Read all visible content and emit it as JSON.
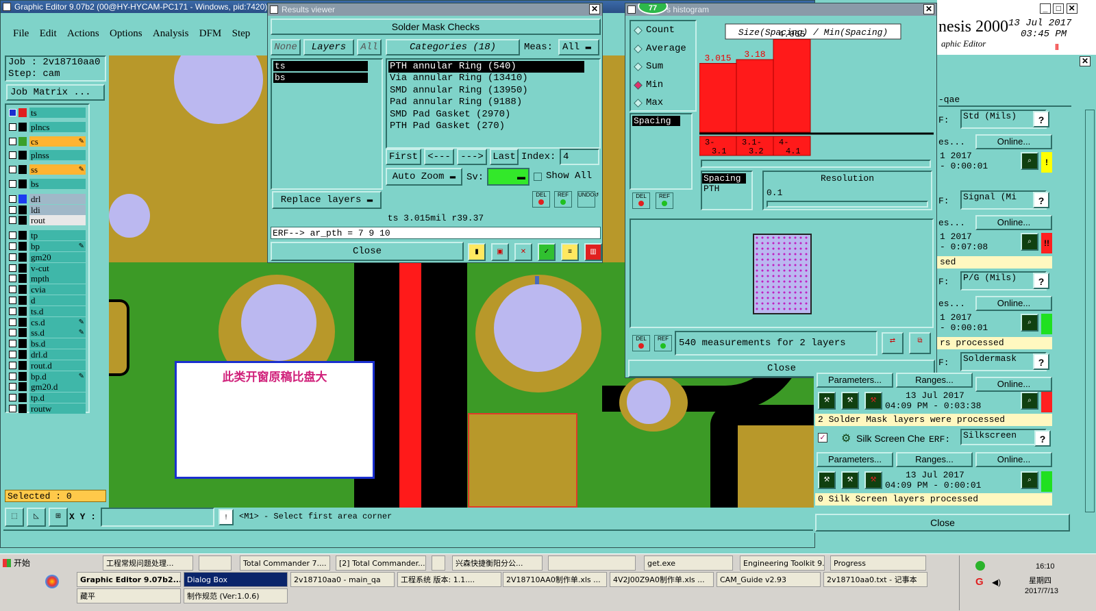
{
  "main": {
    "title": "Graphic Editor 9.07b2 (00@HY-HYCAM-PC171 - Windows, pid:7420)",
    "menu": [
      "File",
      "Edit",
      "Actions",
      "Options",
      "Analysis",
      "DFM",
      "Step"
    ],
    "job_label": "Job : 2v18710aa0",
    "step_label": "Step: cam",
    "job_matrix_button": "Job Matrix ...",
    "layers": [
      {
        "name": "ts",
        "color": "#e02020",
        "active": true
      },
      {
        "name": "plncs",
        "color": "#000000"
      },
      {
        "name": "cs",
        "color": "#3aa02a",
        "highlight": true,
        "mark": true
      },
      {
        "name": "plnss",
        "color": "#000000"
      },
      {
        "name": "ss",
        "color": "#000000",
        "highlight": true,
        "mark": true
      },
      {
        "name": "bs",
        "color": "#000000"
      },
      {
        "name": "drl",
        "color": "#1b3df0",
        "grey": true
      },
      {
        "name": "ldi",
        "color": "#000000",
        "grey": true
      },
      {
        "name": "rout",
        "color": "#000000",
        "white": true
      },
      {
        "name": "tp",
        "color": "#000000"
      },
      {
        "name": "bp",
        "color": "#000000",
        "mark": true
      },
      {
        "name": "gm20",
        "color": "#000000"
      },
      {
        "name": "v-cut",
        "color": "#000000"
      },
      {
        "name": "mpth",
        "color": "#000000"
      },
      {
        "name": "cvia",
        "color": "#000000"
      },
      {
        "name": "d",
        "color": "#000000"
      },
      {
        "name": "ts.d",
        "color": "#000000"
      },
      {
        "name": "cs.d",
        "color": "#000000",
        "mark": true
      },
      {
        "name": "ss.d",
        "color": "#000000",
        "mark": true
      },
      {
        "name": "bs.d",
        "color": "#000000"
      },
      {
        "name": "drl.d",
        "color": "#000000"
      },
      {
        "name": "rout.d",
        "color": "#000000"
      },
      {
        "name": "bp.d",
        "color": "#000000",
        "mark": true
      },
      {
        "name": "gm20.d",
        "color": "#000000"
      },
      {
        "name": "tp.d",
        "color": "#000000"
      },
      {
        "name": "routw",
        "color": "#000000"
      }
    ],
    "selected": "Selected : 0",
    "xy_label": "X Y :",
    "xy_value": "",
    "status_msg": "<M1> - Select first area corner",
    "annotation": "此类开窗原稿比盘大"
  },
  "results": {
    "title": "Results viewer",
    "header": "Solder Mask Checks",
    "none_btn": "None",
    "layers_btn": "Layers",
    "all_btn": "All",
    "categories_btn": "Categories (18)",
    "meas_label": "Meas:",
    "meas_value": "All",
    "layer_list": [
      "ts",
      "bs"
    ],
    "categories": [
      "PTH annular Ring (540)",
      "Via annular Ring (13410)",
      "SMD annular Ring (13950)",
      "Pad annular Ring (9188)",
      "SMD Pad Gasket (2970)",
      "PTH Pad Gasket (270)"
    ],
    "first": "First",
    "prev": "<---",
    "next": "--->",
    "last": "Last",
    "index_label": "Index:",
    "index_value": "4",
    "auto_zoom": "Auto Zoom",
    "sv_label": "Sv:",
    "show_all": "Show All",
    "replace_layers": "Replace layers",
    "del": "DEL",
    "ref": "REF",
    "undo": "UNDO",
    "meas_info": "ts 3.015mil  r39.37",
    "erf_line": "ERF--> ar_pth = 7 9 10",
    "close": "Close"
  },
  "histogram": {
    "title": "s histogram",
    "badge": "77",
    "options": [
      {
        "label": "Count",
        "selected": false
      },
      {
        "label": "Average",
        "selected": false
      },
      {
        "label": "Sum",
        "selected": false
      },
      {
        "label": "Min",
        "selected": true
      },
      {
        "label": "Max",
        "selected": false
      }
    ],
    "chart_title": "Size(Spacing) / Min(Spacing)",
    "list_item": "Spacing",
    "spacing_list": [
      "Spacing",
      "PTH"
    ],
    "resolution_label": "Resolution",
    "resolution_value": "0.1",
    "measurements": "540 measurements for 2 layers",
    "close": "Close",
    "del": "DEL",
    "ref": "REF"
  },
  "chart_data": {
    "type": "bar",
    "title": "Size(Spacing) / Min(Spacing)",
    "categories": [
      "3-3.1",
      "3.1-3.2",
      "4-4.1"
    ],
    "category_labels": [
      [
        "3-",
        "3.1"
      ],
      [
        "3.1-",
        "3.2"
      ],
      [
        "4-",
        "4.1"
      ]
    ],
    "values": [
      3.015,
      3.18,
      4.065
    ],
    "value_labels": [
      "3.015",
      "3.18",
      "4.065"
    ],
    "ylim": [
      0,
      4.5
    ],
    "color": "#ff1a1a"
  },
  "genesis": {
    "brand": "nesis 2000",
    "subtitle": "aphic Editor",
    "date": "13 Jul 2017",
    "time": "03:45 PM",
    "tab": "-qae",
    "rows": [
      {
        "erf": "Std (Mils)",
        "online": "Online...",
        "date": "1 2017",
        "time": "- 0:00:01",
        "status_color": "#ffff00",
        "flag": "!",
        "msg": ""
      },
      {
        "erf": "Signal (Mi",
        "online": "Online...",
        "date": "1 2017",
        "time": "- 0:07:08",
        "status_color": "#ff2020",
        "flag": "!!",
        "msg": "sed"
      },
      {
        "erf": "P/G (Mils)",
        "online": "Online...",
        "date": "1 2017",
        "time": "- 0:00:01",
        "status_color": "#20e020",
        "flag": "",
        "msg": "rs processed"
      },
      {
        "erf": "Soldermask",
        "online": "Online...",
        "date": "",
        "time": "",
        "status_color": "",
        "flag": "",
        "msg": ""
      }
    ],
    "erf_label": "ERF:",
    "params": "Parameters...",
    "ranges": "Ranges...",
    "sm_date": "13 Jul 2017",
    "sm_time": "04:09 PM - 0:03:38",
    "sm_msg": "2 Solder Mask layers were processed",
    "silk_label": "Silk Screen Che",
    "silk_erf": "Silkscreen",
    "silk_date": "13 Jul 2017",
    "silk_time": "04:09 PM - 0:00:01",
    "silk_msg": "0 Silk Screen layers processed",
    "close": "Close",
    "erf_short": "F:",
    "es": "es...",
    "help": "?"
  },
  "taskbar": {
    "start": "开始",
    "row1": [
      "工程常规问题处理...",
      "",
      "Total Commander 7....",
      "[2] Total Commander...",
      "",
      "兴森快捷衡阳分公...",
      "",
      "get.exe",
      "Engineering Toolkit 9....",
      "Progress"
    ],
    "row2": [
      "Graphic Editor 9.07b2...",
      "Dialog Box",
      "2v18710aa0 - main_qa",
      "工程系统  版本: 1.1....",
      "2V18710AA0制作单.xls ...",
      "4V2J00Z9A0制作单.xls ...",
      "CAM_Guide v2.93",
      "2v18710aa0.txt - 记事本"
    ],
    "row3": [
      "藏平",
      "制作规范 (Ver:1.0.6)"
    ],
    "clock_time": "16:10",
    "clock_day": "星期四",
    "clock_date": "2017/7/13"
  }
}
